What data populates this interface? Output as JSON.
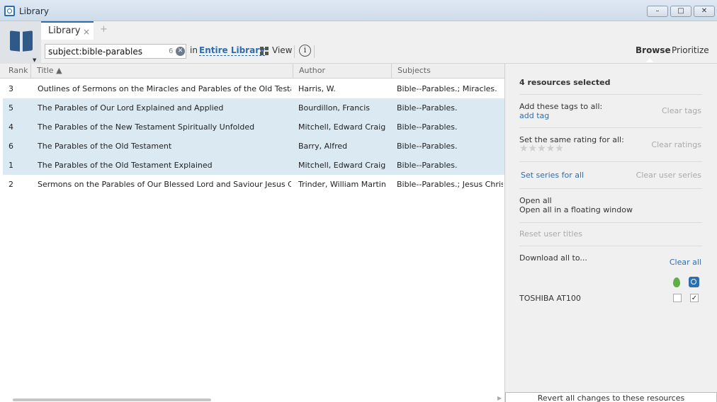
{
  "window": {
    "title": "Library",
    "min": "–",
    "max": "□",
    "close": "✕"
  },
  "tabs": {
    "active_label": "Library",
    "close_glyph": "×",
    "add_glyph": "+"
  },
  "toolbar": {
    "search_query": "subject:bible-parables",
    "result_count": "6",
    "clear_glyph": "✕",
    "in_label": "in",
    "scope": "Entire Library",
    "view_label": "View",
    "info_glyph": "i",
    "browse_label": "Browse",
    "prioritize_label": "Prioritize"
  },
  "table": {
    "headers": {
      "rank": "Rank",
      "title": "Title ▲",
      "author": "Author",
      "subjects": "Subjects"
    },
    "rows": [
      {
        "rank": "3",
        "title": "Outlines of Sermons on the Miracles and Parables of the Old Testament, Or...",
        "author": "Harris, W.",
        "subjects": "Bible--Parables.; Miracles.",
        "selected": false
      },
      {
        "rank": "5",
        "title": "The Parables of Our Lord Explained and Applied",
        "author": "Bourdillon, Francis",
        "subjects": "Bible--Parables.",
        "selected": true
      },
      {
        "rank": "4",
        "title": "The Parables of the New Testament Spiritually Unfolded",
        "author": "Mitchell, Edward Craig",
        "subjects": "Bible--Parables.",
        "selected": true
      },
      {
        "rank": "6",
        "title": "The Parables of the Old Testament",
        "author": "Barry, Alfred",
        "subjects": "Bible--Parables.",
        "selected": true
      },
      {
        "rank": "1",
        "title": "The Parables of the Old Testament Explained",
        "author": "Mitchell, Edward Craig",
        "subjects": "Bible--Parables.",
        "selected": true
      },
      {
        "rank": "2",
        "title": "Sermons on the Parables of Our Blessed Lord and Saviour Jesus Christ",
        "author": "Trinder, William Martin",
        "subjects": "Bible--Parables.; Jesus Christ-...",
        "selected": false
      }
    ]
  },
  "panel": {
    "selected_count": "4 resources selected",
    "tags_label": "Add these tags to all:",
    "add_tag": "add tag",
    "clear_tags": "Clear tags",
    "rating_label": "Set the same rating for all:",
    "stars": "★★★★★",
    "clear_ratings": "Clear ratings",
    "set_series": "Set series for all",
    "clear_series": "Clear user series",
    "open_all": "Open all",
    "open_floating": "Open all in a floating window",
    "reset_titles": "Reset user titles",
    "download_all": "Download all to...",
    "clear_all": "Clear all",
    "device_name": "TOSHIBA AT100",
    "check_mark": "✓",
    "revert": "Revert all changes to these resources"
  }
}
